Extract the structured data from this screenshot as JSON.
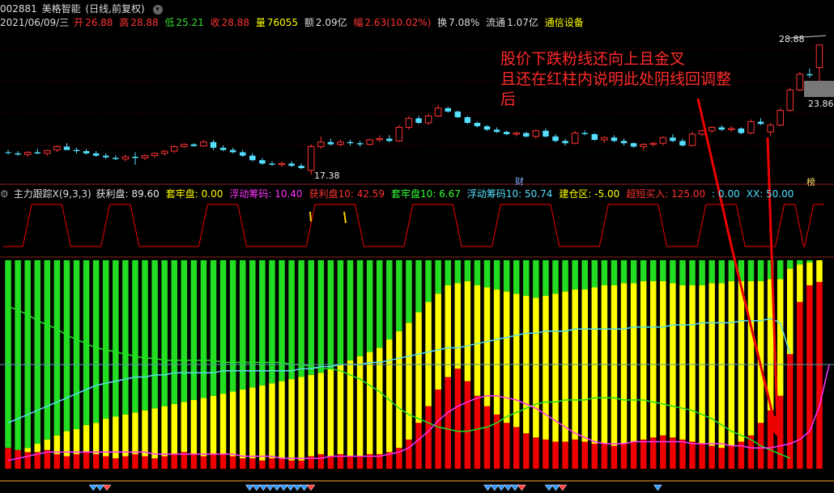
{
  "header": {
    "code": "002881",
    "name": "美格智能",
    "period": "(日线,前复权)",
    "date": "2021/06/09/三",
    "open_label": "开",
    "open": "26.88",
    "high_label": "高",
    "high": "28.88",
    "low_label": "低",
    "low": "25.21",
    "close_label": "收",
    "close": "28.88",
    "vol_label": "量",
    "vol": "76055",
    "amount_label": "额",
    "amount": "2.09亿",
    "amp_label": "幅",
    "amp": "2.63(10.02%)",
    "turnover_label": "换",
    "turnover": "7.08%",
    "float_label": "流通",
    "float": "1.07亿",
    "industry": "通信设备"
  },
  "indicator": {
    "name": "主力跟踪X(9,3,3)",
    "items": [
      {
        "label": "获利盘:",
        "value": "89.60",
        "color": "#e8e8e8"
      },
      {
        "label": "套牢盘:",
        "value": "0.00",
        "color": "#ffff00"
      },
      {
        "label": "浮动筹码:",
        "value": "10.40",
        "color": "#ff33ff"
      },
      {
        "label": "获利盘10:",
        "value": "42.59",
        "color": "#ff3333"
      },
      {
        "label": "套牢盘10:",
        "value": "6.67",
        "color": "#33ff33"
      },
      {
        "label": "浮动筹码10:",
        "value": "50.74",
        "color": "#55e0ff"
      },
      {
        "label": "建仓区:",
        "value": "-5.00",
        "color": "#ffff00"
      },
      {
        "label": "超短买入:",
        "value": "125.00",
        "color": "#ff3333"
      },
      {
        "label": ":",
        "value": "0.00",
        "color": "#55e0ff"
      },
      {
        "label": "XX:",
        "value": "50.00",
        "color": "#55e0ff"
      }
    ]
  },
  "annotation": {
    "lines": [
      "股价下跌粉线还向上且金叉",
      "且还在红柱内说明此处阴线回调整",
      "后"
    ],
    "color": "#ff2a2a"
  },
  "markers": {
    "cai": "财",
    "bang": "榜"
  },
  "colors": {
    "up": "#ff3333",
    "down": "#55e0ff",
    "green": "#22dd22",
    "yellow": "#ffff00",
    "red": "#ee0000",
    "magenta": "#ff33ff",
    "cyan": "#55ddee"
  },
  "chart_data": {
    "type": "candlestick",
    "price_panel": {
      "high_label": "28.88",
      "low_label": "17.38",
      "right_label": "23.86",
      "ohlc": [
        [
          19.4,
          19.6,
          19.2,
          19.35
        ],
        [
          19.3,
          19.5,
          19.1,
          19.2
        ],
        [
          19.2,
          19.5,
          19.0,
          19.4
        ],
        [
          19.4,
          19.7,
          19.2,
          19.3
        ],
        [
          19.3,
          19.6,
          19.1,
          19.55
        ],
        [
          19.6,
          20.0,
          19.4,
          19.9
        ],
        [
          19.9,
          20.2,
          19.6,
          19.6
        ],
        [
          19.6,
          19.8,
          19.3,
          19.5
        ],
        [
          19.5,
          19.7,
          19.2,
          19.3
        ],
        [
          19.3,
          19.5,
          19.0,
          19.1
        ],
        [
          19.1,
          19.3,
          18.8,
          18.95
        ],
        [
          18.9,
          19.1,
          18.7,
          18.8
        ],
        [
          18.8,
          19.2,
          18.6,
          19.0
        ],
        [
          19.0,
          19.4,
          18.3,
          18.9
        ],
        [
          18.9,
          19.2,
          18.7,
          19.1
        ],
        [
          19.1,
          19.4,
          18.9,
          19.3
        ],
        [
          19.3,
          19.6,
          19.1,
          19.5
        ],
        [
          19.5,
          20.0,
          19.3,
          19.9
        ],
        [
          19.9,
          20.2,
          19.8,
          20.1
        ],
        [
          20.1,
          20.2,
          19.9,
          19.95
        ],
        [
          19.95,
          20.5,
          19.9,
          20.3
        ],
        [
          20.3,
          20.5,
          19.6,
          19.8
        ],
        [
          19.8,
          20.0,
          19.5,
          19.6
        ],
        [
          19.6,
          19.8,
          19.3,
          19.4
        ],
        [
          19.4,
          19.6,
          19.0,
          19.1
        ],
        [
          19.1,
          19.3,
          18.6,
          18.7
        ],
        [
          18.7,
          18.9,
          18.3,
          18.4
        ],
        [
          18.4,
          18.6,
          18.2,
          18.3
        ],
        [
          18.3,
          18.6,
          18.1,
          18.4
        ],
        [
          18.4,
          18.6,
          18.1,
          18.2
        ],
        [
          18.2,
          18.4,
          17.9,
          18.0
        ],
        [
          17.8,
          20.1,
          17.4,
          19.9
        ],
        [
          19.9,
          20.8,
          19.7,
          20.3
        ],
        [
          20.3,
          20.6,
          20.0,
          20.1
        ],
        [
          20.1,
          20.5,
          19.9,
          20.3
        ],
        [
          20.3,
          20.5,
          20.0,
          20.2
        ],
        [
          20.2,
          20.4,
          19.9,
          20.1
        ],
        [
          20.1,
          20.6,
          20.0,
          20.5
        ],
        [
          20.5,
          20.9,
          20.3,
          20.6
        ],
        [
          20.6,
          20.9,
          20.3,
          20.4
        ],
        [
          20.4,
          21.8,
          20.3,
          21.6
        ],
        [
          21.6,
          22.6,
          21.4,
          22.4
        ],
        [
          22.4,
          22.6,
          21.9,
          22.0
        ],
        [
          22.0,
          22.8,
          21.8,
          22.6
        ],
        [
          22.6,
          23.6,
          22.5,
          23.3
        ],
        [
          23.3,
          23.4,
          22.9,
          23.0
        ],
        [
          23.0,
          23.1,
          22.4,
          22.5
        ],
        [
          22.5,
          22.6,
          21.9,
          22.0
        ],
        [
          22.0,
          22.1,
          21.6,
          21.7
        ],
        [
          21.7,
          21.8,
          21.3,
          21.4
        ],
        [
          21.4,
          21.6,
          21.1,
          21.2
        ],
        [
          21.2,
          21.3,
          20.9,
          21.0
        ],
        [
          21.0,
          21.2,
          20.8,
          21.1
        ],
        [
          21.1,
          21.2,
          20.7,
          20.8
        ],
        [
          20.8,
          21.4,
          20.6,
          21.3
        ],
        [
          21.3,
          21.5,
          20.7,
          20.8
        ],
        [
          20.8,
          21.0,
          20.3,
          20.4
        ],
        [
          20.4,
          20.6,
          20.0,
          20.2
        ],
        [
          20.2,
          21.3,
          20.1,
          21.1
        ],
        [
          21.1,
          21.3,
          20.9,
          21.0
        ],
        [
          21.0,
          21.1,
          20.4,
          20.5
        ],
        [
          20.5,
          20.8,
          20.2,
          20.7
        ],
        [
          20.7,
          20.9,
          20.3,
          20.4
        ],
        [
          20.4,
          20.6,
          20.0,
          20.2
        ],
        [
          20.2,
          20.3,
          19.8,
          19.9
        ],
        [
          19.9,
          20.2,
          19.6,
          20.1
        ],
        [
          20.1,
          20.3,
          19.9,
          20.2
        ],
        [
          20.2,
          20.8,
          20.0,
          20.7
        ],
        [
          20.7,
          21.0,
          20.3,
          20.4
        ],
        [
          20.4,
          20.6,
          19.9,
          20.0
        ],
        [
          20.0,
          21.2,
          19.9,
          21.0
        ],
        [
          21.0,
          21.4,
          20.8,
          21.3
        ],
        [
          21.3,
          21.7,
          21.1,
          21.6
        ],
        [
          21.6,
          21.8,
          21.3,
          21.4
        ],
        [
          21.4,
          21.7,
          21.2,
          21.5
        ],
        [
          21.5,
          21.6,
          21.0,
          21.1
        ],
        [
          21.1,
          22.3,
          21.0,
          22.1
        ],
        [
          22.1,
          22.4,
          21.8,
          21.9
        ],
        [
          21.2,
          22.0,
          20.8,
          21.8
        ],
        [
          21.8,
          23.3,
          21.7,
          23.1
        ],
        [
          23.1,
          25.1,
          23.0,
          24.9
        ],
        [
          24.9,
          26.5,
          24.8,
          26.3
        ],
        [
          26.3,
          26.8,
          26.0,
          26.2
        ],
        [
          26.88,
          28.88,
          25.21,
          28.88
        ]
      ]
    },
    "indicator_panel": {
      "series": [
        {
          "name": "获利盘",
          "color": "#ee0000",
          "values": [
            10,
            9,
            8,
            8,
            9,
            7,
            6,
            7,
            8,
            7,
            6,
            5,
            6,
            7,
            6,
            5,
            6,
            7,
            8,
            7,
            6,
            7,
            7,
            6,
            5,
            5,
            4,
            5,
            5,
            4,
            4,
            6,
            7,
            6,
            7,
            6,
            6,
            7,
            7,
            8,
            10,
            14,
            22,
            30,
            38,
            44,
            48,
            42,
            35,
            30,
            26,
            22,
            20,
            17,
            15,
            14,
            13,
            13,
            14,
            13,
            12,
            12,
            11,
            12,
            13,
            14,
            15,
            16,
            15,
            14,
            13,
            12,
            11,
            10,
            11,
            13,
            16,
            22,
            28,
            35,
            55,
            80,
            88,
            89.6
          ]
        },
        {
          "name": "套牢盘",
          "color": "#22dd22",
          "values": [
            92,
            91,
            90,
            88,
            86,
            84,
            82,
            81,
            79,
            78,
            76,
            75,
            74,
            73,
            72,
            71,
            70,
            69,
            68,
            67,
            66,
            65,
            64,
            63,
            62,
            61,
            60,
            59,
            58,
            57,
            56,
            55,
            54,
            52,
            50,
            48,
            46,
            44,
            42,
            38,
            34,
            30,
            25,
            20,
            16,
            12,
            11,
            10,
            12,
            13,
            14,
            15,
            16,
            17,
            18,
            17,
            16,
            15,
            14,
            14,
            13,
            12,
            12,
            11,
            11,
            10,
            10,
            10,
            11,
            12,
            12,
            12,
            11,
            11,
            10,
            10,
            10,
            10,
            9,
            9,
            4,
            2,
            1,
            0
          ]
        },
        {
          "name": "XX",
          "color": "#ff33ff",
          "values": [
            4,
            5,
            6,
            7,
            8,
            8,
            8,
            8,
            8,
            8,
            8,
            8,
            8,
            8,
            8,
            7,
            7,
            7,
            7,
            7,
            7,
            7,
            7,
            7,
            6,
            6,
            6,
            6,
            5,
            5,
            5,
            5,
            5,
            6,
            6,
            6,
            6,
            6,
            6,
            7,
            8,
            10,
            14,
            18,
            23,
            27,
            30,
            32,
            34,
            35,
            35,
            34,
            33,
            31,
            29,
            26,
            23,
            20,
            17,
            15,
            13,
            12,
            12,
            12,
            13,
            13,
            13,
            13,
            13,
            13,
            12,
            12,
            12,
            12,
            11,
            11,
            10,
            10,
            10,
            11,
            12,
            14,
            18,
            30,
            50
          ]
        },
        {
          "name": "套牢盘10",
          "color": "#22dd22",
          "values": [
            78,
            76,
            74,
            71,
            69,
            67,
            64,
            62,
            60,
            58,
            57,
            56,
            55,
            54,
            53,
            53,
            52,
            52,
            52,
            52,
            52,
            52,
            51,
            51,
            51,
            51,
            51,
            51,
            51,
            50,
            50,
            49,
            48,
            48,
            47,
            45,
            43,
            40,
            37,
            33,
            29,
            26,
            24,
            22,
            20,
            19,
            18,
            18,
            19,
            20,
            22,
            25,
            27,
            29,
            31,
            32,
            32,
            33,
            33,
            33,
            34,
            34,
            34,
            33,
            33,
            33,
            32,
            31,
            30,
            29,
            28,
            26,
            24,
            21,
            18,
            16,
            14,
            11,
            9,
            7,
            5
          ]
        },
        {
          "name": "浮动筹码10",
          "color": "#55ddee",
          "values": [
            22,
            24,
            26,
            28,
            30,
            32,
            34,
            36,
            38,
            40,
            41,
            42,
            43,
            44,
            44,
            45,
            45,
            46,
            46,
            46,
            46,
            46,
            47,
            47,
            47,
            47,
            47,
            47,
            47,
            47,
            48,
            48,
            49,
            49,
            50,
            50,
            50,
            51,
            51,
            52,
            53,
            54,
            55,
            56,
            57,
            58,
            58,
            59,
            60,
            61,
            62,
            63,
            64,
            65,
            65,
            66,
            66,
            66,
            67,
            67,
            67,
            67,
            67,
            67,
            68,
            68,
            68,
            68,
            69,
            69,
            69,
            70,
            70,
            70,
            70,
            71,
            71,
            71,
            72,
            70,
            55
          ]
        }
      ]
    }
  }
}
